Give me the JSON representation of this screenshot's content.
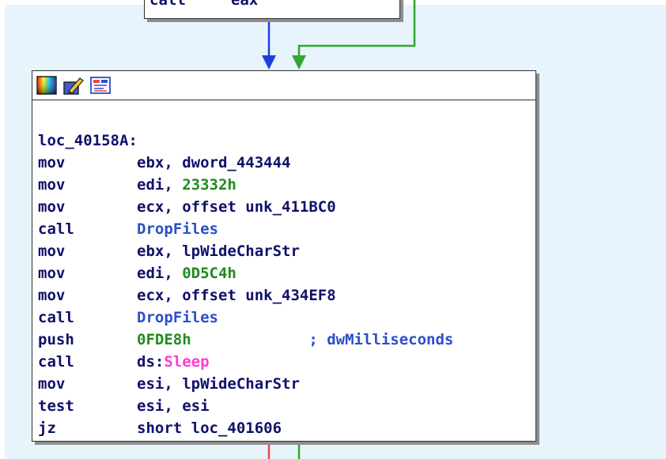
{
  "top_block": {
    "mnemonic": "call",
    "operand": "eax"
  },
  "toolbar": {
    "icons": [
      "color-palette-icon",
      "edit-pencil-icon",
      "graph-view-icon"
    ]
  },
  "label": "loc_40158A:",
  "instructions": [
    {
      "mnemonic": "mov",
      "parts": [
        {
          "t": "ebx, dword_443444",
          "c": ""
        }
      ]
    },
    {
      "mnemonic": "mov",
      "parts": [
        {
          "t": "edi, ",
          "c": ""
        },
        {
          "t": "23332h",
          "c": "c-num"
        }
      ]
    },
    {
      "mnemonic": "mov",
      "parts": [
        {
          "t": "ecx, offset unk_411BC0",
          "c": ""
        }
      ]
    },
    {
      "mnemonic": "call",
      "parts": [
        {
          "t": "DropFiles",
          "c": "c-fn"
        }
      ]
    },
    {
      "mnemonic": "mov",
      "parts": [
        {
          "t": "ebx, lpWideCharStr",
          "c": ""
        }
      ]
    },
    {
      "mnemonic": "mov",
      "parts": [
        {
          "t": "edi, ",
          "c": ""
        },
        {
          "t": "0D5C4h",
          "c": "c-num"
        }
      ]
    },
    {
      "mnemonic": "mov",
      "parts": [
        {
          "t": "ecx, offset unk_434EF8",
          "c": ""
        }
      ]
    },
    {
      "mnemonic": "call",
      "parts": [
        {
          "t": "DropFiles",
          "c": "c-fn"
        }
      ]
    },
    {
      "mnemonic": "push",
      "parts": [
        {
          "t": "0FDE8h",
          "c": "c-num"
        },
        {
          "t": "             ; dwMilliseconds",
          "c": "c-cmt"
        }
      ]
    },
    {
      "mnemonic": "call",
      "parts": [
        {
          "t": "ds:",
          "c": ""
        },
        {
          "t": "Sleep",
          "c": "c-imp"
        }
      ]
    },
    {
      "mnemonic": "mov",
      "parts": [
        {
          "t": "esi, lpWideCharStr",
          "c": ""
        }
      ]
    },
    {
      "mnemonic": "test",
      "parts": [
        {
          "t": "esi, esi",
          "c": ""
        }
      ]
    },
    {
      "mnemonic": "jz",
      "parts": [
        {
          "t": "short loc_401606",
          "c": ""
        }
      ]
    }
  ],
  "colors": {
    "edge_true": "#2ea82e",
    "edge_false": "#e84a4a",
    "edge_uncond": "#1f3fe0",
    "background": "#e8f4fb"
  }
}
